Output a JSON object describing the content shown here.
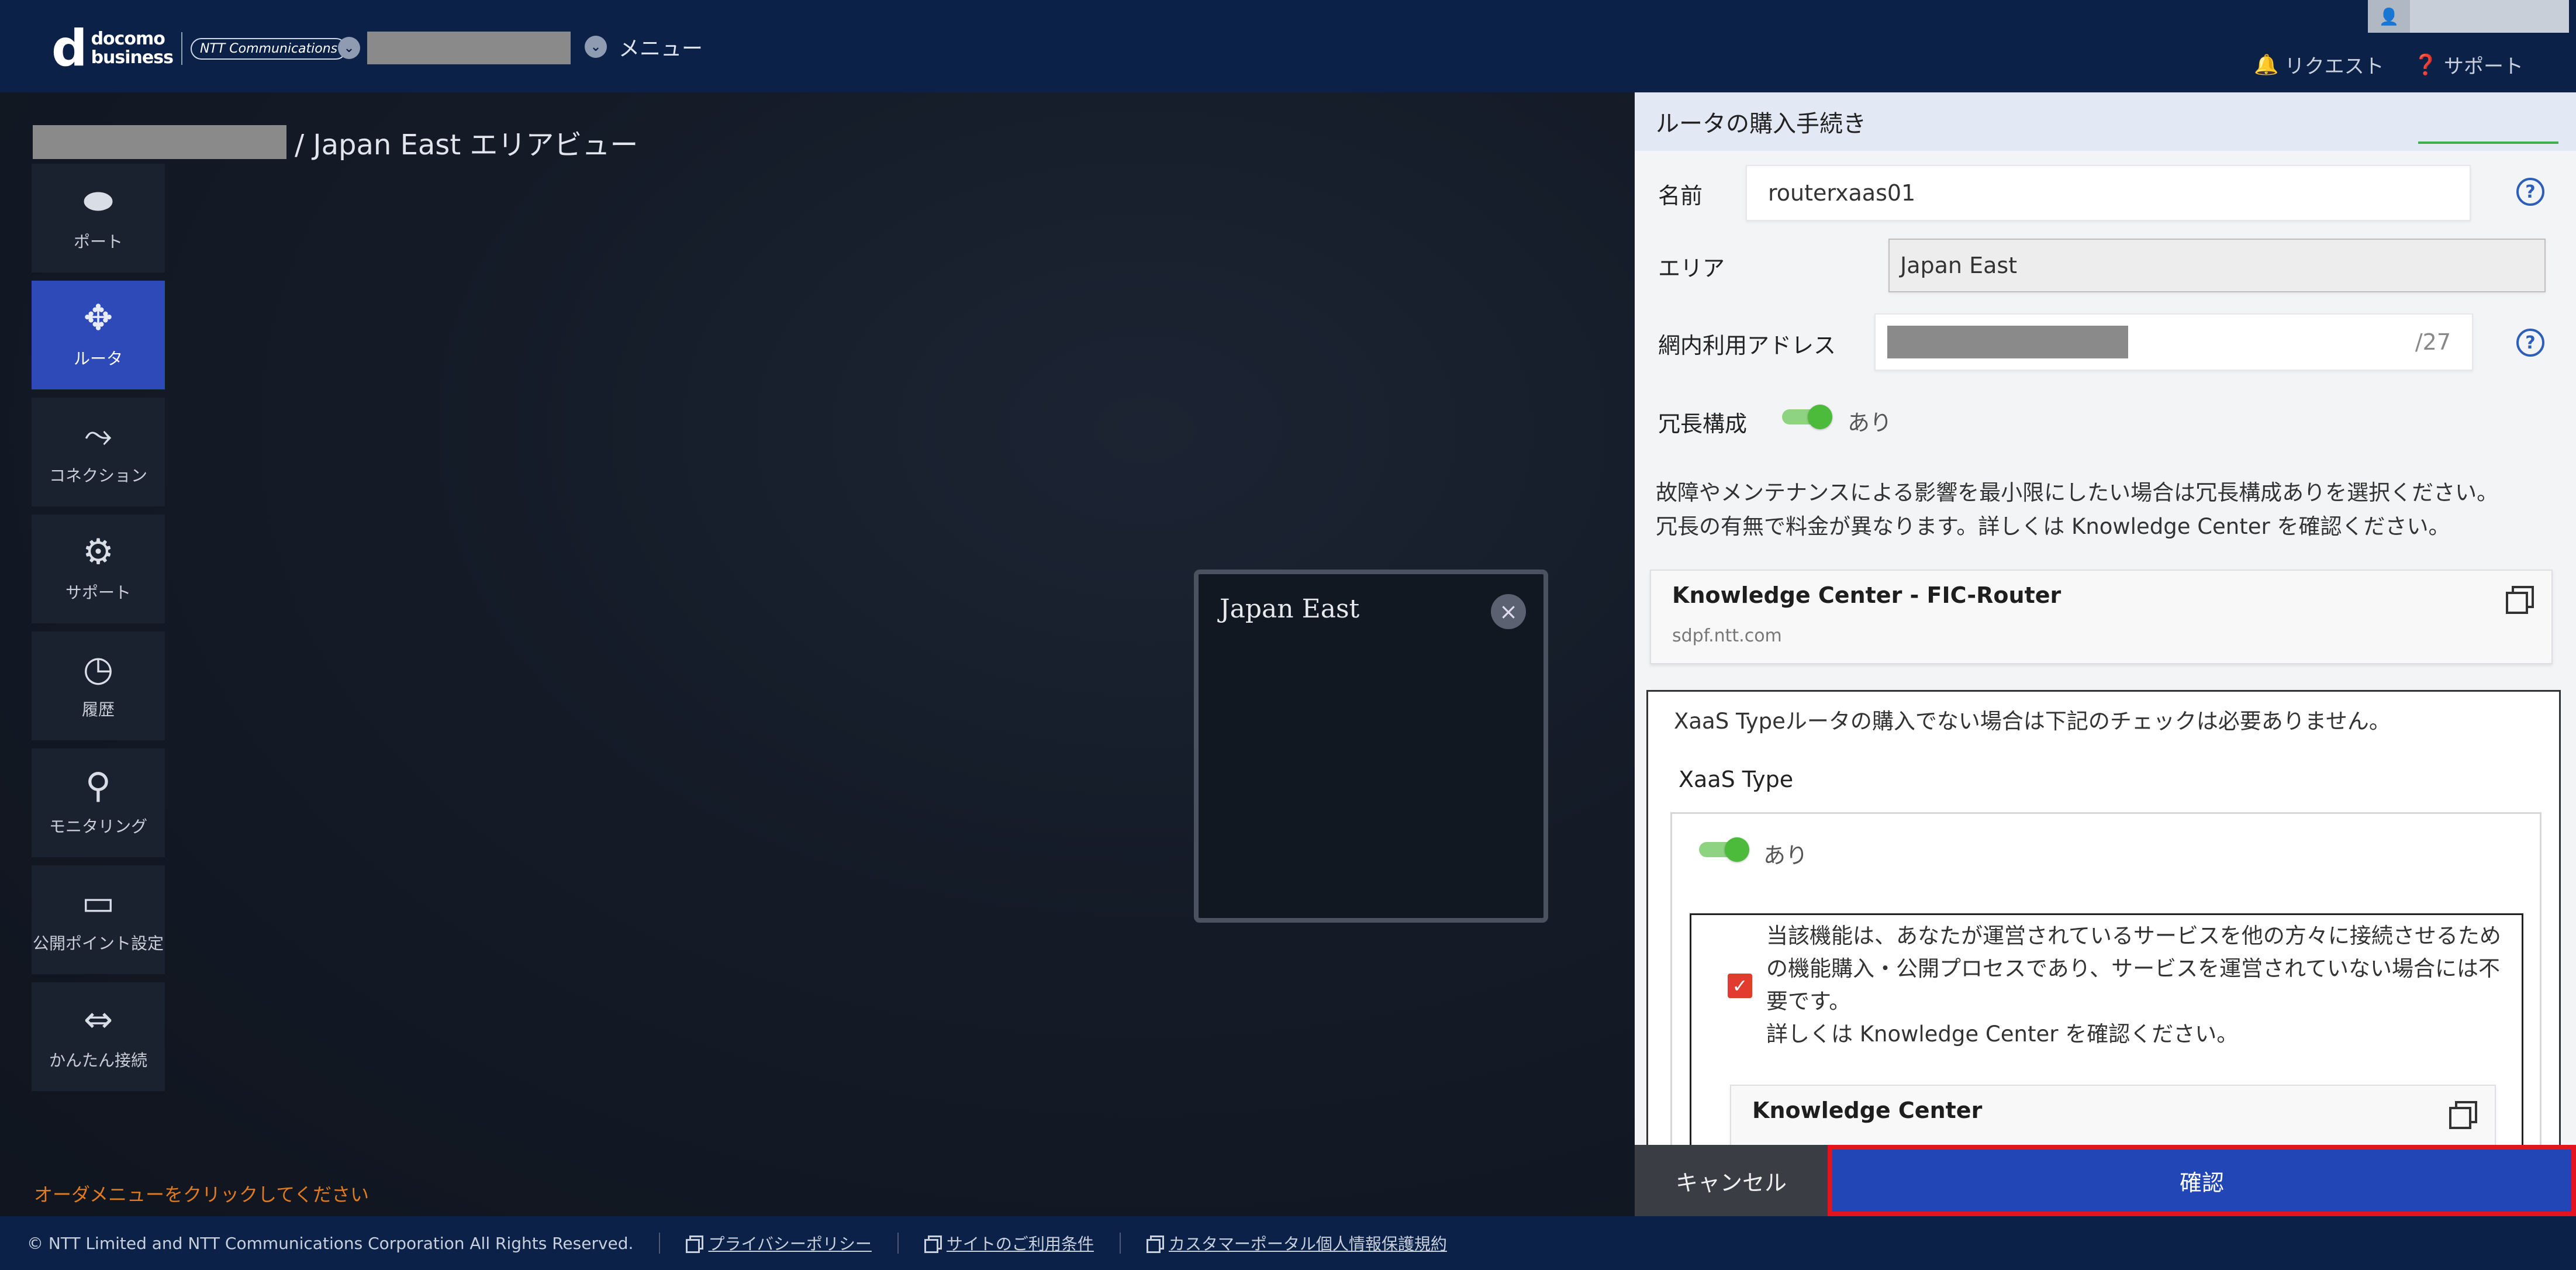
{
  "header": {
    "logo_mark": "d",
    "logo_line1": "docomo",
    "logo_line2": "business",
    "ntt_logo": "NTT Communications",
    "menu_label": "メニュー",
    "request_label": "リクエスト",
    "support_label": "サポート",
    "user_icon": "user-icon"
  },
  "main": {
    "breadcrumb_suffix": "/ Japan East エリアビュー",
    "order_hint": "オーダメニューをクリックしてください"
  },
  "sidebar": {
    "items": [
      {
        "label": "ポート",
        "icon": "port-icon"
      },
      {
        "label": "ルータ",
        "icon": "router-icon",
        "active": true
      },
      {
        "label": "コネクション",
        "icon": "connection-icon"
      },
      {
        "label": "サポート",
        "icon": "support-icon"
      },
      {
        "label": "履歴",
        "icon": "history-icon"
      },
      {
        "label": "モニタリング",
        "icon": "monitoring-icon"
      },
      {
        "label": "公開ポイント設定",
        "icon": "public-point-icon"
      },
      {
        "label": "かんたん接続",
        "icon": "easy-connect-icon"
      }
    ]
  },
  "popup": {
    "title": "Japan East",
    "close": "×"
  },
  "panel": {
    "title": "ルータの購入手続き",
    "name_label": "名前",
    "name_value": "routerxaas01",
    "area_label": "エリア",
    "area_value": "Japan East",
    "address_label": "網内利用アドレス",
    "address_suffix": "/27",
    "redundancy_label": "冗長構成",
    "redundancy_value": "あり",
    "redundancy_note_1": "故障やメンテナンスによる影響を最小限にしたい場合は冗長構成ありを選択ください。",
    "redundancy_note_2": "冗長の有無で料金が異なります。詳しくは Knowledge Center を確認ください。",
    "kc_card_title": "Knowledge Center - FIC-Router",
    "kc_card_url": "sdpf.ntt.com",
    "xaas_intro": "XaaS Typeルータの購入でない場合は下記のチェックは必要ありません。",
    "xaas_label": "XaaS Type",
    "xaas_value": "あり",
    "consent_text_1": "当該機能は、あなたが運営されているサービスを他の方々に接続させるための機能購入・公開プロセスであり、サービスを運営されていない場合には不要です。",
    "consent_text_2": "詳しくは Knowledge Center を確認ください。",
    "kc2_title": "Knowledge Center",
    "help_glyph": "?",
    "check_glyph": "✓"
  },
  "actions": {
    "cancel_label": "キャンセル",
    "confirm_label": "確認"
  },
  "footer": {
    "copyright": "© NTT Limited and NTT Communications Corporation All Rights Reserved.",
    "privacy": "プライバシーポリシー",
    "terms": "サイトのご利用条件",
    "personal_info": "カスタマーポータル個人情報保護規約"
  },
  "colors": {
    "header_bg": "#0b2147",
    "accent_blue": "#2246b6",
    "highlight_red": "#e4131d",
    "toggle_green": "#4cbb3c",
    "hint_orange": "#e07a1d"
  }
}
